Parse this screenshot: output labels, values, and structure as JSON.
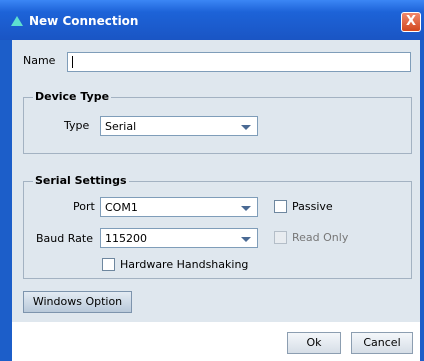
{
  "window": {
    "title": "New Connection",
    "close_label": "X"
  },
  "name_field": {
    "label": "Name",
    "value": ""
  },
  "device_type": {
    "group_title": "Device Type",
    "type_label": "Type",
    "type_value": "Serial"
  },
  "serial_settings": {
    "group_title": "Serial Settings",
    "port_label": "Port",
    "port_value": "COM1",
    "baud_label": "Baud Rate",
    "baud_value": "115200",
    "passive_label": "Passive",
    "read_only_label": "Read Only",
    "hardware_handshaking_label": "Hardware Handshaking"
  },
  "windows_option_label": "Windows Option",
  "buttons": {
    "ok_label": "Ok",
    "cancel_label": "Cancel"
  },
  "colors": {
    "titlebar": "#1d63d8",
    "panel": "#dfe7ee",
    "close": "#d2471d"
  },
  "icons": {
    "title": "app-triangle-icon",
    "close": "close-icon",
    "dropdown": "chevron-down-icon"
  }
}
